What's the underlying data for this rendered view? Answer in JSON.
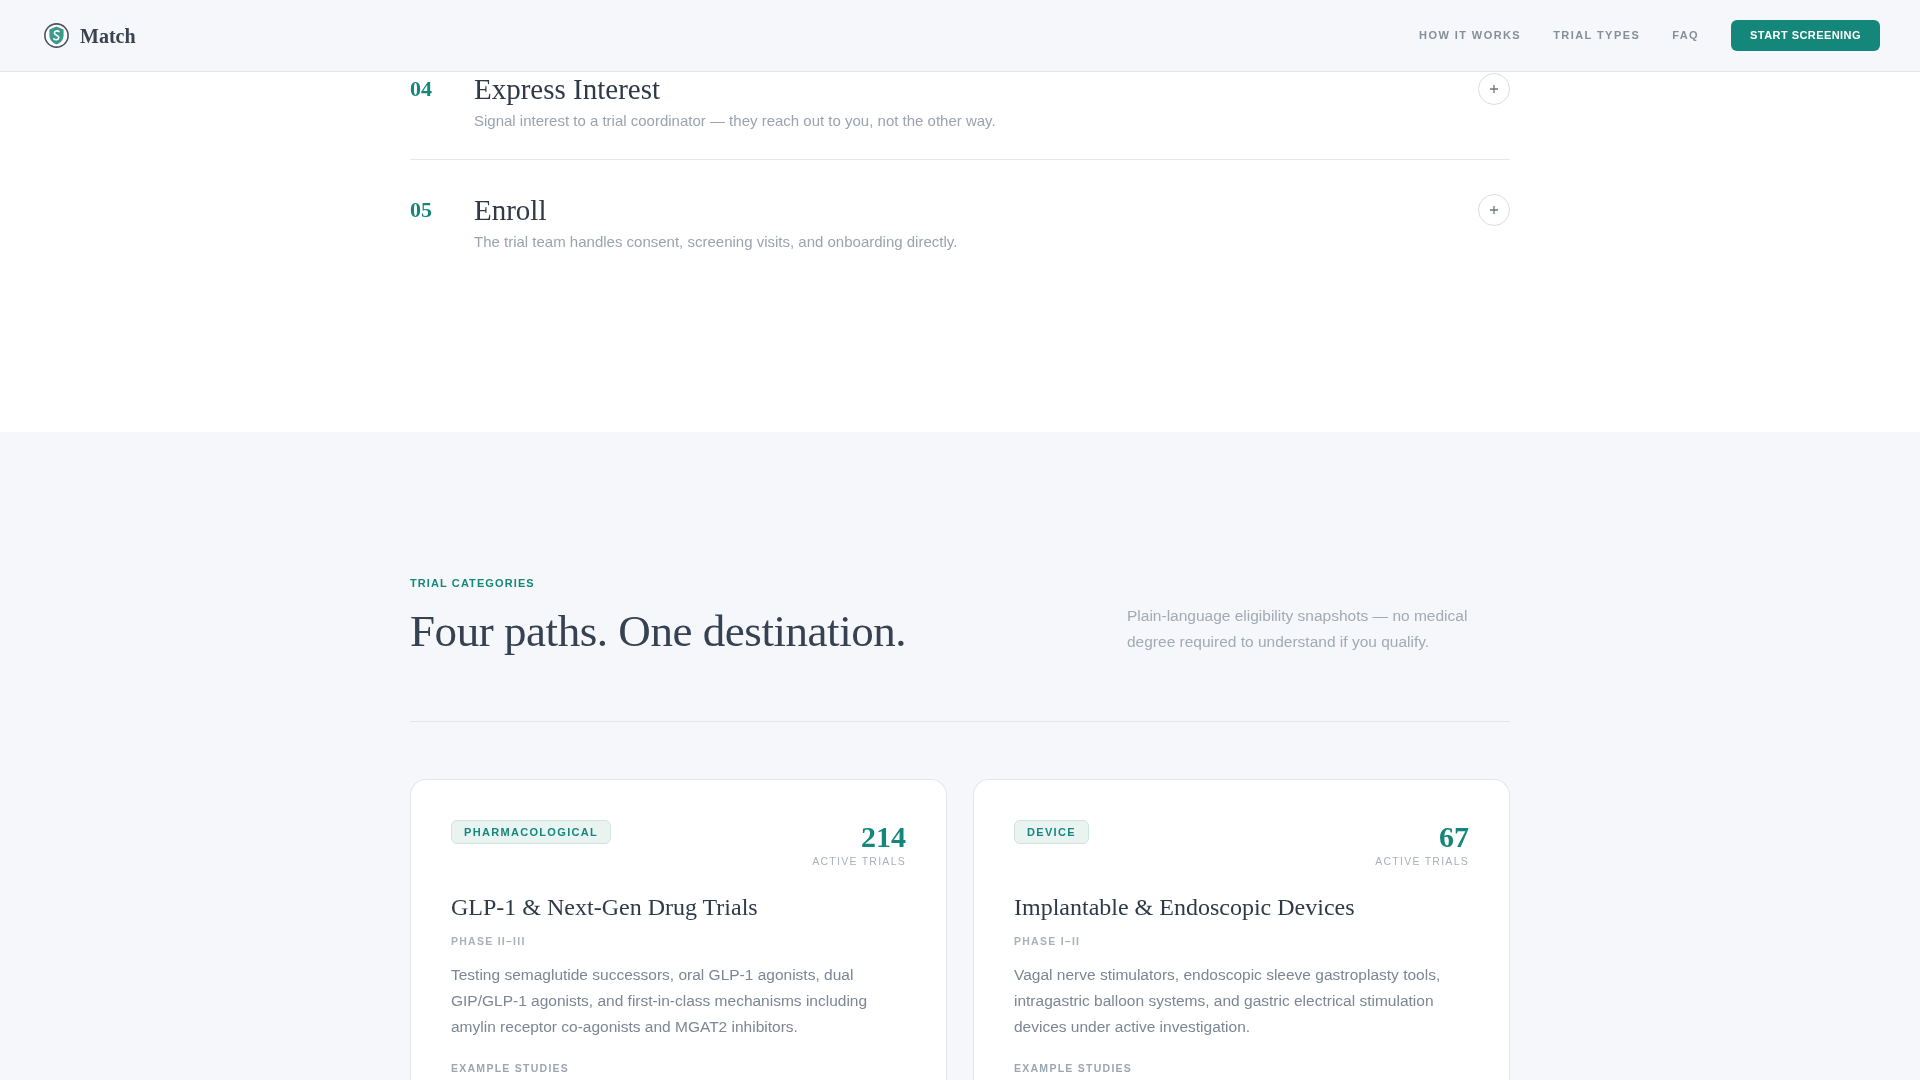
{
  "navbar": {
    "brand": "Match",
    "links": [
      "HOW IT WORKS",
      "TRIAL TYPES",
      "FAQ"
    ],
    "cta": "START SCREENING"
  },
  "steps": [
    {
      "number": "04",
      "title": "Express Interest",
      "description": "Signal interest to a trial coordinator — they reach out to you, not the other way.",
      "expanded": false
    },
    {
      "number": "05",
      "title": "Enroll",
      "description": "The trial team handles consent, screening visits, and onboarding directly.",
      "expanded": false
    }
  ],
  "trial_categories": {
    "eyebrow": "TRIAL CATEGORIES",
    "heading": "Four paths. One destination.",
    "intro": "Plain-language eligibility snapshots — no medical degree required to understand if you qualify.",
    "cards": [
      {
        "tag": "PHARMACOLOGICAL",
        "count": "214",
        "count_label": "ACTIVE TRIALS",
        "title": "GLP-1 & Next-Gen Drug Trials",
        "phase": "PHASE II–III",
        "description": "Testing semaglutide successors, oral GLP-1 agonists, dual GIP/GLP-1 agonists, and first-in-class mechanisms including amylin receptor co-agonists and MGAT2 inhibitors.",
        "section_label": "EXAMPLE STUDIES"
      },
      {
        "tag": "DEVICE",
        "count": "67",
        "count_label": "ACTIVE TRIALS",
        "title": "Implantable & Endoscopic Devices",
        "phase": "PHASE I–II",
        "description": "Vagal nerve stimulators, endoscopic sleeve gastroplasty tools, intragastric balloon systems, and gastric electrical stimulation devices under active investigation.",
        "section_label": "EXAMPLE STUDIES"
      }
    ]
  }
}
